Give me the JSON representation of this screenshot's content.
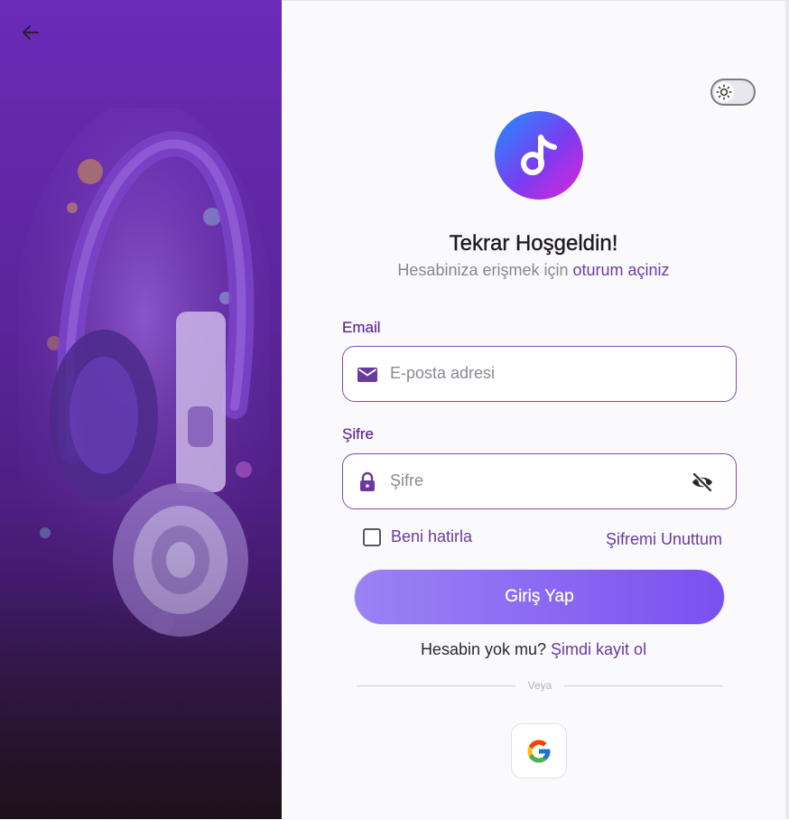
{
  "header": {
    "title": "Tekrar Hoşgeldin!",
    "subtitle_prefix": "Hesabiniza erişmek için",
    "subtitle_link": "oturum açiniz"
  },
  "form": {
    "email_label": "Email",
    "email_placeholder": "E-posta adresi",
    "password_label": "Şifre",
    "password_placeholder": "Şifre",
    "remember_label": "Beni hatirla",
    "remember_checked": false,
    "forgot_label": "Şifremi Unuttum",
    "submit_label": "Giriş Yap"
  },
  "signup": {
    "prompt": "Hesabin yok mu?",
    "link": "Şimdi kayit ol"
  },
  "divider_label": "Veya",
  "icons": {
    "back": "arrow-left-icon",
    "theme": "sun-icon",
    "logo": "music-note-icon",
    "email": "envelope-icon",
    "password": "lock-icon",
    "visibility": "eye-off-icon",
    "google": "google-icon"
  },
  "colors": {
    "accent": "#6a3a9e",
    "button_start": "#9a82f4",
    "button_end": "#7a4ff0",
    "sidebar": "#5b2499"
  }
}
